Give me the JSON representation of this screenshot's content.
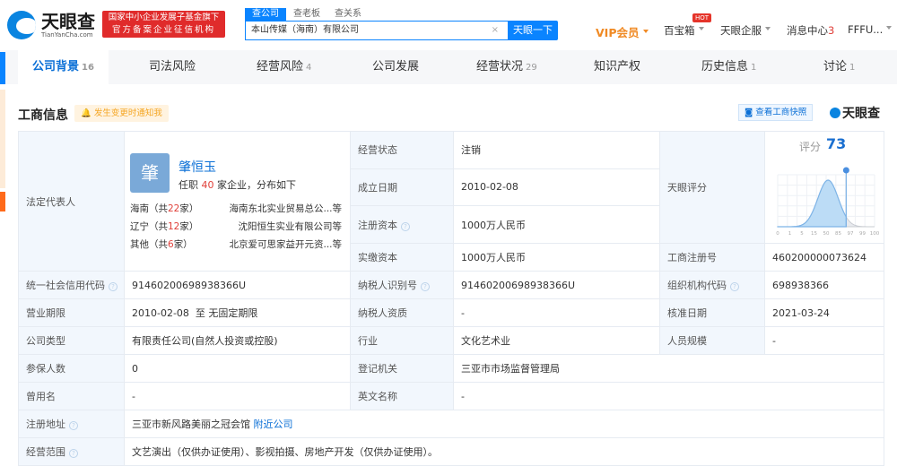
{
  "header": {
    "logo_cn": "天眼查",
    "logo_en": "TianYanCha.com",
    "badge_line1": "国家中小企业发展子基金旗下",
    "badge_line2": "官方备案企业征信机构",
    "search_tabs": [
      "查公司",
      "查老板",
      "查关系"
    ],
    "search_value": "本山传媒（海南）有限公司",
    "search_button": "天眼一下",
    "vip": "VIP会员",
    "baibaoxiang": "百宝箱",
    "hot": "HOT",
    "qifu": "天眼企服",
    "messages": "消息中心",
    "message_count": "3",
    "user": "FFFU..."
  },
  "tabs": [
    {
      "label": "公司背景",
      "count": "16"
    },
    {
      "label": "司法风险",
      "count": ""
    },
    {
      "label": "经营风险",
      "count": "4"
    },
    {
      "label": "公司发展",
      "count": ""
    },
    {
      "label": "经营状况",
      "count": "29"
    },
    {
      "label": "知识产权",
      "count": ""
    },
    {
      "label": "历史信息",
      "count": "1"
    },
    {
      "label": "讨论",
      "count": "1"
    }
  ],
  "section": {
    "title": "工商信息",
    "notify": "发生变更时通知我",
    "snapshot": "查看工商快照",
    "brand": "天眼查"
  },
  "rep": {
    "label": "法定代表人",
    "avatar": "肇",
    "name": "肇恒玉",
    "count_pre": "任职",
    "count": "40",
    "count_post": "家企业，分布如下",
    "regions": [
      {
        "pre": "海南（共",
        "n": "22",
        "post": "家）",
        "company": "海南东北实业贸易总公...等"
      },
      {
        "pre": "辽宁（共",
        "n": "12",
        "post": "家）",
        "company": "沈阳恒生实业有限公司等"
      },
      {
        "pre": "其他（共",
        "n": "6",
        "post": "家）",
        "company": "北京爱可思家益开元资...等"
      }
    ]
  },
  "fields": {
    "status": {
      "label": "经营状态",
      "value": "注销"
    },
    "founded": {
      "label": "成立日期",
      "value": "2010-02-08"
    },
    "reg_capital": {
      "label": "注册资本",
      "value": "1000万人民币"
    },
    "paid_capital": {
      "label": "实缴资本",
      "value": "1000万人民币"
    },
    "score_label": "天眼评分",
    "reg_no": {
      "label": "工商注册号",
      "value": "460200000073624"
    },
    "credit_code": {
      "label": "统一社会信用代码",
      "value": "91460200698938366U"
    },
    "taxpayer_id": {
      "label": "纳税人识别号",
      "value": "91460200698938366U"
    },
    "org_code": {
      "label": "组织机构代码",
      "value": "698938366"
    },
    "term": {
      "label": "营业期限",
      "value": "2010-02-08  至 无固定期限"
    },
    "taxpayer_qual": {
      "label": "纳税人资质",
      "value": "-"
    },
    "approve_date": {
      "label": "核准日期",
      "value": "2021-03-24"
    },
    "type": {
      "label": "公司类型",
      "value": "有限责任公司(自然人投资或控股)"
    },
    "industry": {
      "label": "行业",
      "value": "文化艺术业"
    },
    "staff": {
      "label": "人员规模",
      "value": "-"
    },
    "insured": {
      "label": "参保人数",
      "value": "0"
    },
    "authority": {
      "label": "登记机关",
      "value": "三亚市市场监督管理局"
    },
    "former_name": {
      "label": "曾用名",
      "value": "-"
    },
    "english_name": {
      "label": "英文名称",
      "value": "-"
    },
    "address": {
      "label": "注册地址",
      "value": "三亚市新风路美丽之冠会馆",
      "link": "附近公司"
    },
    "scope": {
      "label": "经营范围",
      "value": "文艺演出（仅供办证使用）、影视拍摄、房地产开发（仅供办证使用）。"
    }
  },
  "chart_data": {
    "type": "area",
    "title": "评分",
    "score": 73,
    "x_ticks": [
      "0",
      "1",
      "5",
      "15",
      "50",
      "85",
      "97",
      "99",
      "100"
    ]
  },
  "colors": {
    "brand": "#0a84ff",
    "vip": "#f08a24",
    "red": "#e0403a"
  }
}
